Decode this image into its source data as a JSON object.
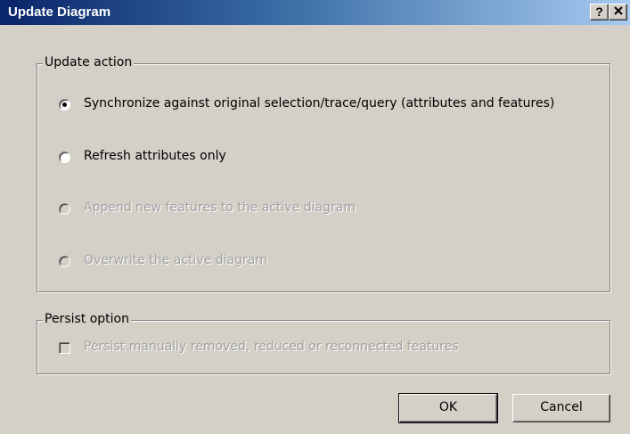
{
  "window": {
    "title": "Update Diagram",
    "help_label": "?"
  },
  "update_action": {
    "legend": "Update action",
    "options": [
      {
        "label": "Synchronize against original selection/trace/query (attributes and features)",
        "selected": true,
        "enabled": true
      },
      {
        "label": "Refresh attributes only",
        "selected": false,
        "enabled": true
      },
      {
        "label": "Append new features to the active diagram",
        "selected": false,
        "enabled": false
      },
      {
        "label": "Overwrite the active diagram",
        "selected": false,
        "enabled": false
      }
    ]
  },
  "persist_option": {
    "legend": "Persist option",
    "checkbox_label": "Persist manually removed, reduced or reconnected features",
    "checked": false,
    "enabled": false
  },
  "buttons": {
    "ok": "OK",
    "cancel": "Cancel"
  }
}
